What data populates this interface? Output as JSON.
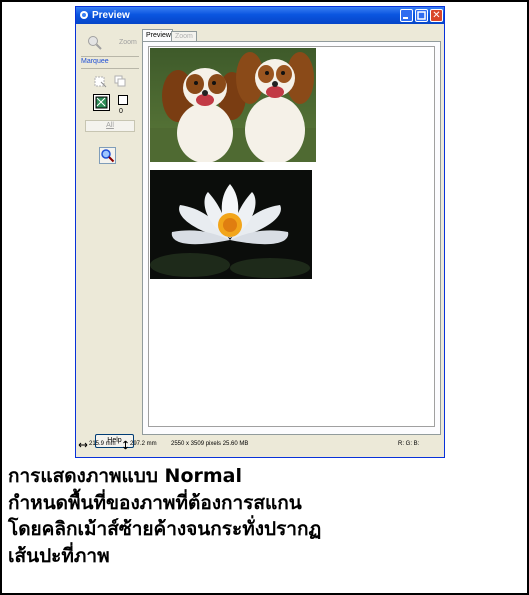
{
  "window": {
    "title": "Preview"
  },
  "titlebar": {
    "close_glyph": "✕"
  },
  "left_panel": {
    "zoom_label": "Zoom",
    "marquee_label": "Marquee",
    "count_value": "0",
    "all_label": "All",
    "help_label": "Help"
  },
  "tabs": [
    {
      "label": "Preview"
    },
    {
      "label": "Zoom"
    }
  ],
  "status_bar": {
    "width": "215.9 mm",
    "height": "297.2 mm",
    "pixels": "2550 x 3509 pixels 25.60 MB",
    "rgb": "R: G: B:"
  },
  "icons": [
    "app-icon",
    "zoom-icon",
    "marquee-icon",
    "marquee-copy-icon",
    "auto-locate-icon",
    "zoom-tool-icon"
  ],
  "caption": {
    "line1": "การแสดงภาพแบบ Normal",
    "line2": "กำหนดพื้นที่ของภาพที่ต้องการสแกน",
    "line3": "โดยคลิกเม้าส์ซ้ายค้างจนกระทั่งปรากฏ",
    "line4": "เส้นปะที่ภาพ"
  }
}
